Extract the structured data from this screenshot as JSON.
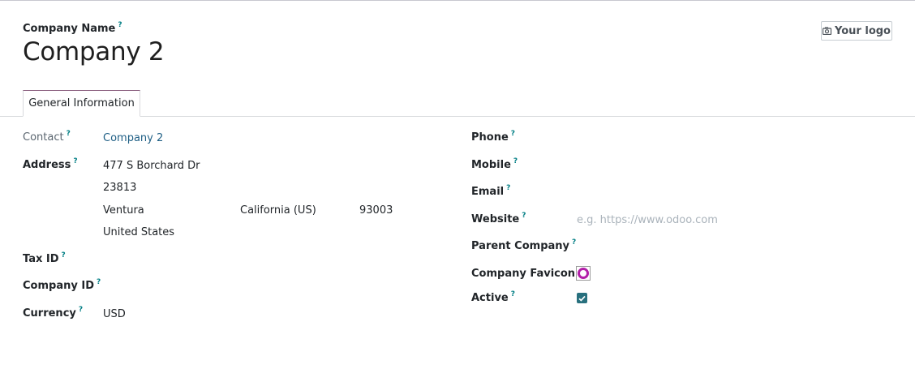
{
  "header": {
    "company_name_label": "Company Name",
    "company_name_value": "Company 2",
    "logo_button_label": "Your logo"
  },
  "tabs": [
    {
      "label": "General Information",
      "active": true
    }
  ],
  "help_marker": "?",
  "left": {
    "contact_label": "Contact",
    "contact_value": "Company 2",
    "address_label": "Address",
    "address": {
      "street": "477 S Borchard Dr",
      "street2": "23813",
      "city": "Ventura",
      "state": "California (US)",
      "zip": "93003",
      "country": "United States"
    },
    "tax_id_label": "Tax ID",
    "company_id_label": "Company ID",
    "currency_label": "Currency",
    "currency_value": "USD"
  },
  "right": {
    "phone_label": "Phone",
    "mobile_label": "Mobile",
    "email_label": "Email",
    "website_label": "Website",
    "website_placeholder": "e.g. https://www.odoo.com",
    "parent_company_label": "Parent Company",
    "favicon_label": "Company Favicon",
    "active_label": "Active",
    "active_checked": true
  },
  "colors": {
    "accent": "#875a7b",
    "help": "#017e84",
    "link": "#1f5f85",
    "checkbox": "#28707e",
    "favicon_ring": "#b21fa8"
  }
}
